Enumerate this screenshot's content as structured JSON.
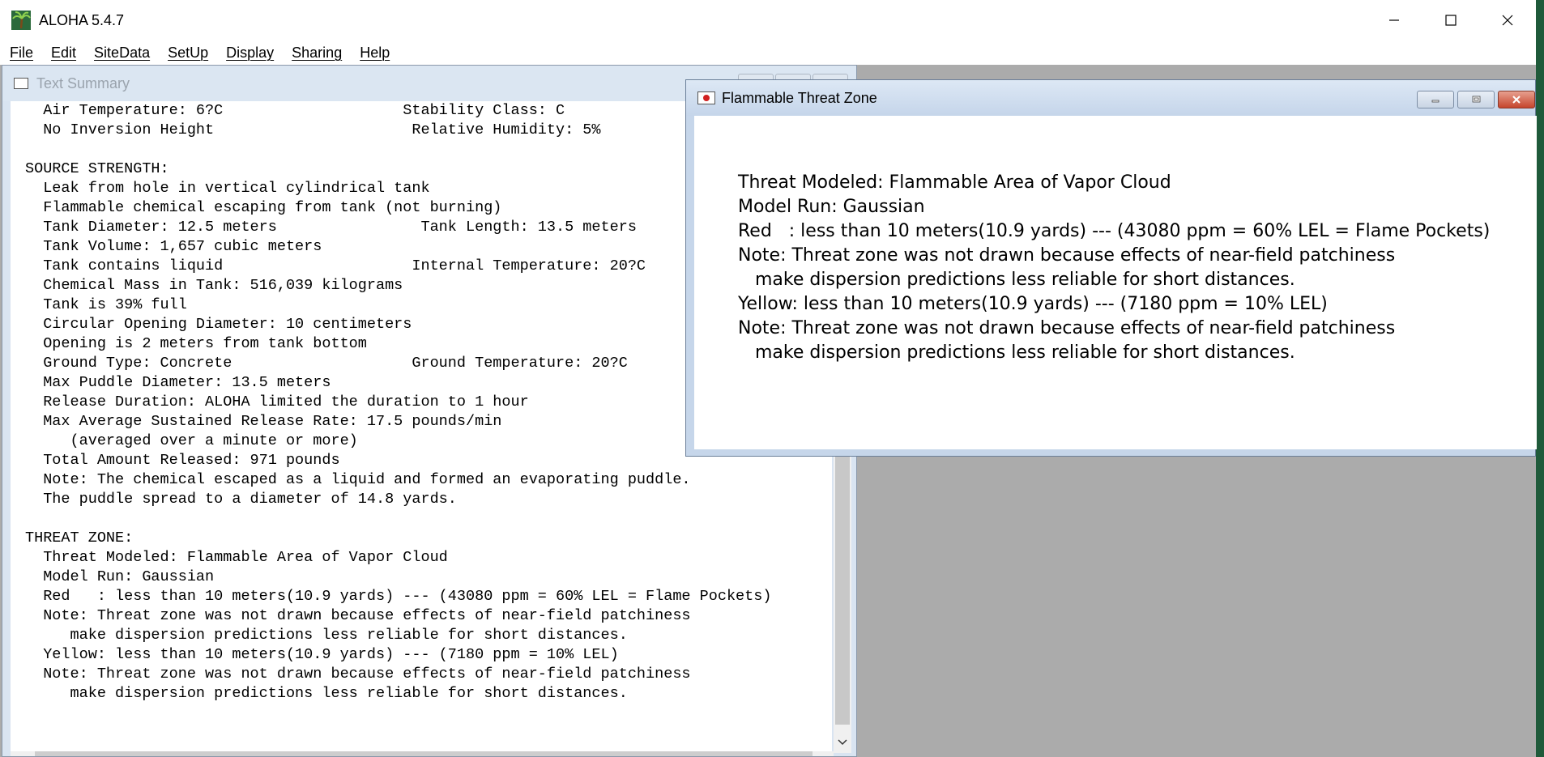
{
  "app": {
    "title": "ALOHA 5.4.7",
    "icon": "palm-tree-icon"
  },
  "window_controls": {
    "minimize": "minimize-icon",
    "maximize": "maximize-icon",
    "close": "close-icon"
  },
  "menu": {
    "items": [
      {
        "label": "File"
      },
      {
        "label": "Edit"
      },
      {
        "label": "SiteData"
      },
      {
        "label": "SetUp"
      },
      {
        "label": "Display"
      },
      {
        "label": "Sharing"
      },
      {
        "label": "Help"
      }
    ]
  },
  "summary_window": {
    "title": "Text Summary",
    "lines": [
      "  Air Temperature: 6?C                    Stability Class: C",
      "  No Inversion Height                      Relative Humidity: 5%",
      "",
      "SOURCE STRENGTH:",
      "  Leak from hole in vertical cylindrical tank",
      "  Flammable chemical escaping from tank (not burning)",
      "  Tank Diameter: 12.5 meters                Tank Length: 13.5 meters",
      "  Tank Volume: 1,657 cubic meters",
      "  Tank contains liquid                     Internal Temperature: 20?C",
      "  Chemical Mass in Tank: 516,039 kilograms",
      "  Tank is 39% full",
      "  Circular Opening Diameter: 10 centimeters",
      "  Opening is 2 meters from tank bottom",
      "  Ground Type: Concrete                    Ground Temperature: 20?C",
      "  Max Puddle Diameter: 13.5 meters",
      "  Release Duration: ALOHA limited the duration to 1 hour",
      "  Max Average Sustained Release Rate: 17.5 pounds/min",
      "     (averaged over a minute or more)",
      "  Total Amount Released: 971 pounds",
      "  Note: The chemical escaped as a liquid and formed an evaporating puddle.",
      "  The puddle spread to a diameter of 14.8 yards.",
      "",
      "THREAT ZONE:",
      "  Threat Modeled: Flammable Area of Vapor Cloud",
      "  Model Run: Gaussian",
      "  Red   : less than 10 meters(10.9 yards) --- (43080 ppm = 60% LEL = Flame Pockets)",
      "  Note: Threat zone was not drawn because effects of near-field patchiness",
      "     make dispersion predictions less reliable for short distances.",
      "  Yellow: less than 10 meters(10.9 yards) --- (7180 ppm = 10% LEL)",
      "  Note: Threat zone was not drawn because effects of near-field patchiness",
      "     make dispersion predictions less reliable for short distances."
    ]
  },
  "threat_window": {
    "title": "Flammable Threat Zone",
    "lines": [
      "Threat Modeled: Flammable Area of Vapor Cloud",
      "Model Run: Gaussian",
      "Red   : less than 10 meters(10.9 yards) --- (43080 ppm = 60% LEL = Flame Pockets)",
      "Note: Threat zone was not drawn because effects of near-field patchiness",
      "   make dispersion predictions less reliable for short distances.",
      "Yellow: less than 10 meters(10.9 yards) --- (7180 ppm = 10% LEL)",
      "Note: Threat zone was not drawn because effects of near-field patchiness",
      "   make dispersion predictions less reliable for short distances."
    ]
  }
}
